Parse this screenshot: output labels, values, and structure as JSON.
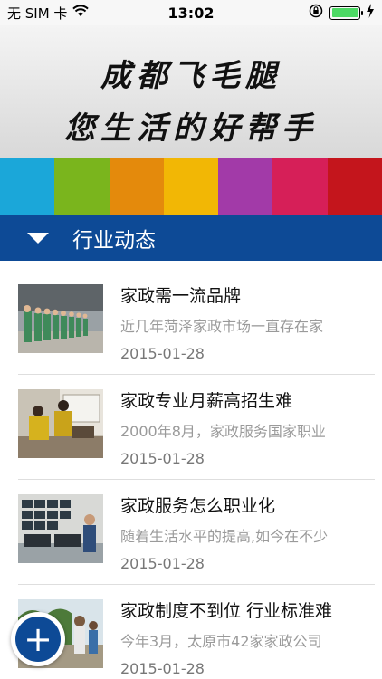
{
  "status_bar": {
    "carrier": "无 SIM 卡",
    "time": "13:02",
    "battery_level": 1.0,
    "icons": [
      "wifi-icon",
      "rotation-lock-icon",
      "battery-icon",
      "charging-icon"
    ]
  },
  "banner": {
    "line1": "成都飞毛腿",
    "line2": "您生活的好帮手",
    "stripe_colors": [
      "#1ba7d9",
      "#7ab51d",
      "#e48a0c",
      "#f2b705",
      "#a23aa8",
      "#d61f58",
      "#c4151c"
    ]
  },
  "section": {
    "title": "行业动态",
    "icon": "triangle-down-icon",
    "color": "#0d4a96"
  },
  "news": [
    {
      "title": "家政需一流品牌",
      "summary": "近几年菏泽家政市场一直存在家",
      "date": "2015-01-28"
    },
    {
      "title": "家政专业月薪高招生难",
      "summary": "2000年8月，家政服务国家职业",
      "date": "2015-01-28"
    },
    {
      "title": "家政服务怎么职业化",
      "summary": "随着生活水平的提高,如今在不少",
      "date": "2015-01-28"
    },
    {
      "title": "家政制度不到位 行业标准难",
      "summary": "今年3月，太原市42家家政公司",
      "date": "2015-01-28"
    }
  ],
  "fab": {
    "symbol": "+",
    "icon": "add-icon"
  }
}
